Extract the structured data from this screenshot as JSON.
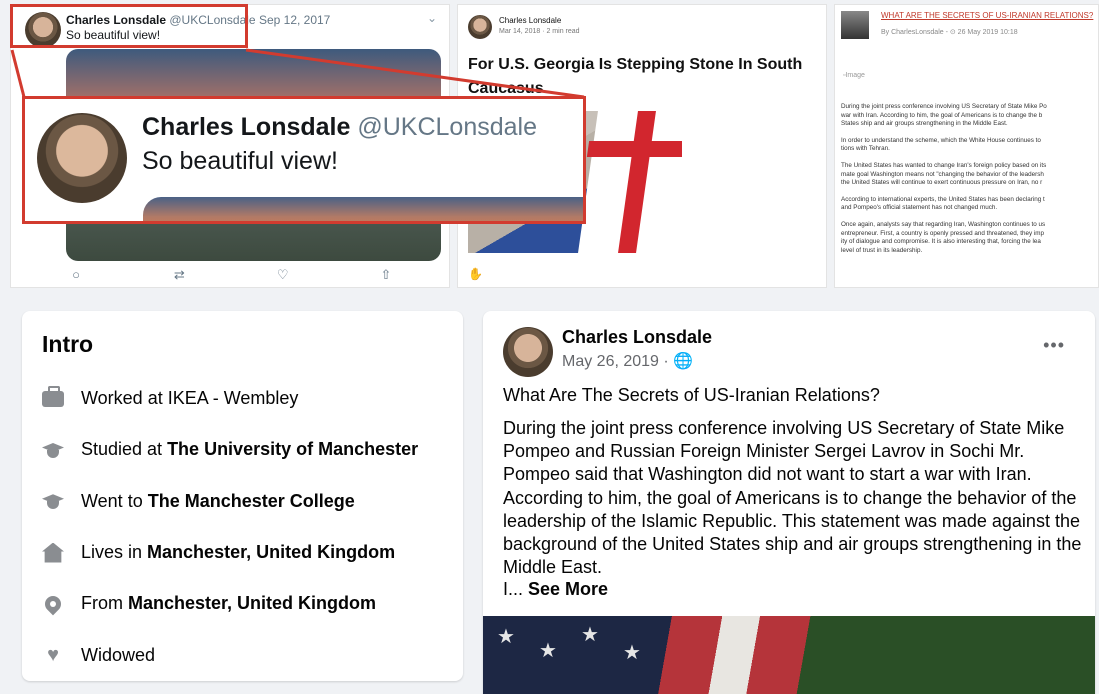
{
  "tweet": {
    "name": "Charles Lonsdale",
    "handle": "@UKCLonsdale",
    "date": "Sep 12, 2017",
    "text": "So beautiful view!"
  },
  "zoom": {
    "name": "Charles Lonsdale",
    "handle": "@UKCLonsdale",
    "text": "So beautiful view!"
  },
  "medium": {
    "author": "Charles Lonsdale",
    "meta": "Mar 14, 2018 · 2 min read",
    "title": "For U.S. Georgia Is Stepping Stone In South Caucasus"
  },
  "blog": {
    "title": "WHAT ARE THE SECRETS OF US-IRANIAN RELATIONS?",
    "meta": "By CharlesLonsdale - ⊙ 26 May 2019 10:18",
    "image_label": "Image",
    "paragraphs": [
      "During the joint press conference involving US Secretary of State Mike Po\nwar with Iran. According to him, the goal of Americans is to change the b\nStates ship and air groups strengthening in the Middle East.",
      "In order to understand the scheme, which the White House continues to\ntions with Tehran.",
      "The United States has wanted to change Iran's foreign policy based on its\nmate goal Washington means not \"changing the behavior of the leadersh\nthe United States will continue to exert continuous pressure on Iran, no r",
      "According to international experts, the United States has been declaring t\nand Pompeo's official statement has not changed much.",
      "Once again, analysts say that regarding Iran, Washington continues to us\nentrepreneur. First, a country is openly pressed and threatened, they imp\nity of dialogue and compromise. It is also interesting that, forcing the lea\nlevel of trust in its leadership."
    ]
  },
  "intro": {
    "title": "Intro",
    "items": [
      {
        "icon": "briefcase-icon",
        "prefix": "Worked at IKEA - Wembley",
        "strong": ""
      },
      {
        "icon": "graduation-cap-icon",
        "prefix": "Studied at ",
        "strong": "The University of Manchester"
      },
      {
        "icon": "graduation-cap-icon",
        "prefix": "Went to ",
        "strong": "The Manchester College"
      },
      {
        "icon": "home-icon",
        "prefix": "Lives in ",
        "strong": "Manchester, United Kingdom"
      },
      {
        "icon": "location-pin-icon",
        "prefix": "From ",
        "strong": "Manchester, United Kingdom"
      },
      {
        "icon": "heart-icon",
        "prefix": "Widowed",
        "strong": ""
      }
    ]
  },
  "post": {
    "name": "Charles Lonsdale",
    "date": "May 26, 2019 · 🌐",
    "more": "•••",
    "title": "What Are The Secrets of US-Iranian Relations?",
    "body": "During the joint press conference involving US Secretary of State Mike Pompeo and Russian Foreign Minister Sergei Lavrov in Sochi Mr. Pompeo said that Washington did not want to start a war with Iran. According to him, the goal of Americans is to change the behavior of the leadership of the Islamic Republic. This statement was made against the background of the United States ship and air groups strengthening in the Middle East.",
    "see_more_prefix": "I... ",
    "see_more": "See More"
  },
  "colors": {
    "highlight": "#d23b2f",
    "fb_background": "#f0f2f5",
    "icon_gray": "#8a8d91"
  }
}
